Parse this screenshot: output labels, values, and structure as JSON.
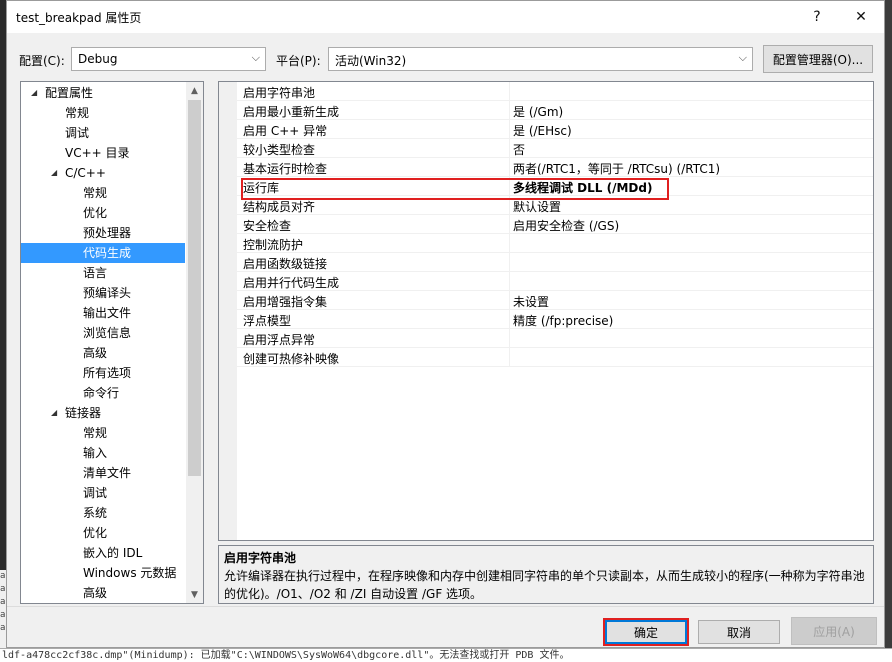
{
  "window": {
    "title": "test_breakpad 属性页",
    "help_label": "?",
    "close_label": "✕"
  },
  "config": {
    "config_label": "配置(C):",
    "config_value": "Debug",
    "platform_label": "平台(P):",
    "platform_value": "活动(Win32)",
    "manager_label": "配置管理器(O)..."
  },
  "tree": {
    "items": [
      {
        "label": "配置属性",
        "level": 0,
        "expander": "◢"
      },
      {
        "label": "常规",
        "level": 1
      },
      {
        "label": "调试",
        "level": 1
      },
      {
        "label": "VC++ 目录",
        "level": 1
      },
      {
        "label": "C/C++",
        "level": 1,
        "expander": "◢"
      },
      {
        "label": "常规",
        "level": 2
      },
      {
        "label": "优化",
        "level": 2
      },
      {
        "label": "预处理器",
        "level": 2
      },
      {
        "label": "代码生成",
        "level": 2,
        "selected": true
      },
      {
        "label": "语言",
        "level": 2
      },
      {
        "label": "预编译头",
        "level": 2
      },
      {
        "label": "输出文件",
        "level": 2
      },
      {
        "label": "浏览信息",
        "level": 2
      },
      {
        "label": "高级",
        "level": 2
      },
      {
        "label": "所有选项",
        "level": 2
      },
      {
        "label": "命令行",
        "level": 2
      },
      {
        "label": "链接器",
        "level": 1,
        "expander": "◢"
      },
      {
        "label": "常规",
        "level": 2
      },
      {
        "label": "输入",
        "level": 2
      },
      {
        "label": "清单文件",
        "level": 2
      },
      {
        "label": "调试",
        "level": 2
      },
      {
        "label": "系统",
        "level": 2
      },
      {
        "label": "优化",
        "level": 2
      },
      {
        "label": "嵌入的 IDL",
        "level": 2
      },
      {
        "label": "Windows 元数据",
        "level": 2
      },
      {
        "label": "高级",
        "level": 2
      }
    ]
  },
  "grid": {
    "rows": [
      {
        "name": "启用字符串池",
        "value": ""
      },
      {
        "name": "启用最小重新生成",
        "value": "是 (/Gm)"
      },
      {
        "name": "启用 C++ 异常",
        "value": "是 (/EHsc)"
      },
      {
        "name": "较小类型检查",
        "value": "否"
      },
      {
        "name": "基本运行时检查",
        "value": "两者(/RTC1，等同于 /RTCsu) (/RTC1)"
      },
      {
        "name": "运行库",
        "value": "多线程调试 DLL (/MDd)",
        "bold": true
      },
      {
        "name": "结构成员对齐",
        "value": "默认设置"
      },
      {
        "name": "安全检查",
        "value": "启用安全检查 (/GS)"
      },
      {
        "name": "控制流防护",
        "value": ""
      },
      {
        "name": "启用函数级链接",
        "value": ""
      },
      {
        "name": "启用并行代码生成",
        "value": ""
      },
      {
        "name": "启用增强指令集",
        "value": "未设置"
      },
      {
        "name": "浮点模型",
        "value": "精度 (/fp:precise)"
      },
      {
        "name": "启用浮点异常",
        "value": ""
      },
      {
        "name": "创建可热修补映像",
        "value": ""
      }
    ]
  },
  "description": {
    "title": "启用字符串池",
    "body": "允许编译器在执行过程中，在程序映像和内存中创建相同字符串的单个只读副本，从而生成较小的程序(一种称为字符串池的优化)。/O1、/O2 和 /ZI 自动设置 /GF 选项。"
  },
  "buttons": {
    "ok": "确定",
    "cancel": "取消",
    "apply": "应用(A)"
  },
  "background": {
    "console_line": "ldf-a478cc2cf38c.dmp\"(Minidump): 已加载\"C:\\WINDOWS\\SysWoW64\\dbgcore.dll\"。无法查找或打开 PDB 文件。",
    "left_edge_lines": [
      "al",
      "al",
      "al",
      "al",
      "al"
    ]
  },
  "colors": {
    "selection": "#3399ff",
    "highlight_box": "#e02020",
    "primary_border": "#0078d7"
  }
}
